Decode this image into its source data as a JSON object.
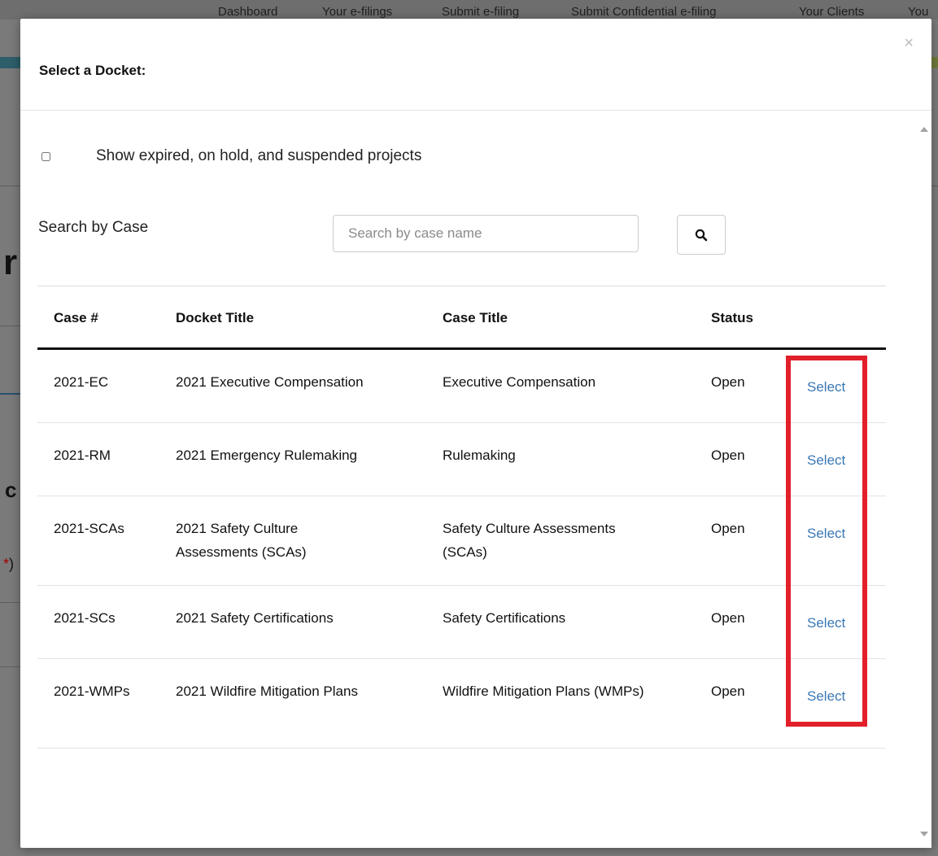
{
  "background_nav": [
    "Dashboard",
    "Your e-filings",
    "Submit e-filing",
    "Submit Confidential e-filing",
    "Your Clients",
    "You"
  ],
  "modal": {
    "title": "Select a Docket:",
    "close_label": "×"
  },
  "filter": {
    "show_expired_label": "Show expired, on hold, and suspended projects",
    "checked": false
  },
  "search": {
    "label": "Search by Case",
    "placeholder": "Search by case name",
    "value": ""
  },
  "table": {
    "headers": {
      "case": "Case #",
      "docket": "Docket Title",
      "title": "Case Title",
      "status": "Status"
    },
    "rows": [
      {
        "case": "2021-EC",
        "docket": "2021 Executive Compensation",
        "title": "Executive Compensation",
        "status": "Open",
        "action": "Select"
      },
      {
        "case": "2021-RM",
        "docket": "2021 Emergency Rulemaking",
        "title": "Rulemaking",
        "status": "Open",
        "action": "Select"
      },
      {
        "case": "2021-SCAs",
        "docket": "2021 Safety Culture Assessments (SCAs)",
        "title": "Safety Culture Assessments (SCAs)",
        "status": "Open",
        "action": "Select"
      },
      {
        "case": "2021-SCs",
        "docket": "2021 Safety Certifications",
        "title": "Safety Certifications",
        "status": "Open",
        "action": "Select"
      },
      {
        "case": "2021-WMPs",
        "docket": "2021 Wildfire Mitigation Plans",
        "title": "Wildfire Mitigation Plans (WMPs)",
        "status": "Open",
        "action": "Select"
      }
    ]
  },
  "icons": {
    "search": "search-icon",
    "close": "close-icon"
  },
  "colors": {
    "link": "#3a78b5",
    "highlight": "#e1202a",
    "overlay": "#7a7a7a"
  }
}
